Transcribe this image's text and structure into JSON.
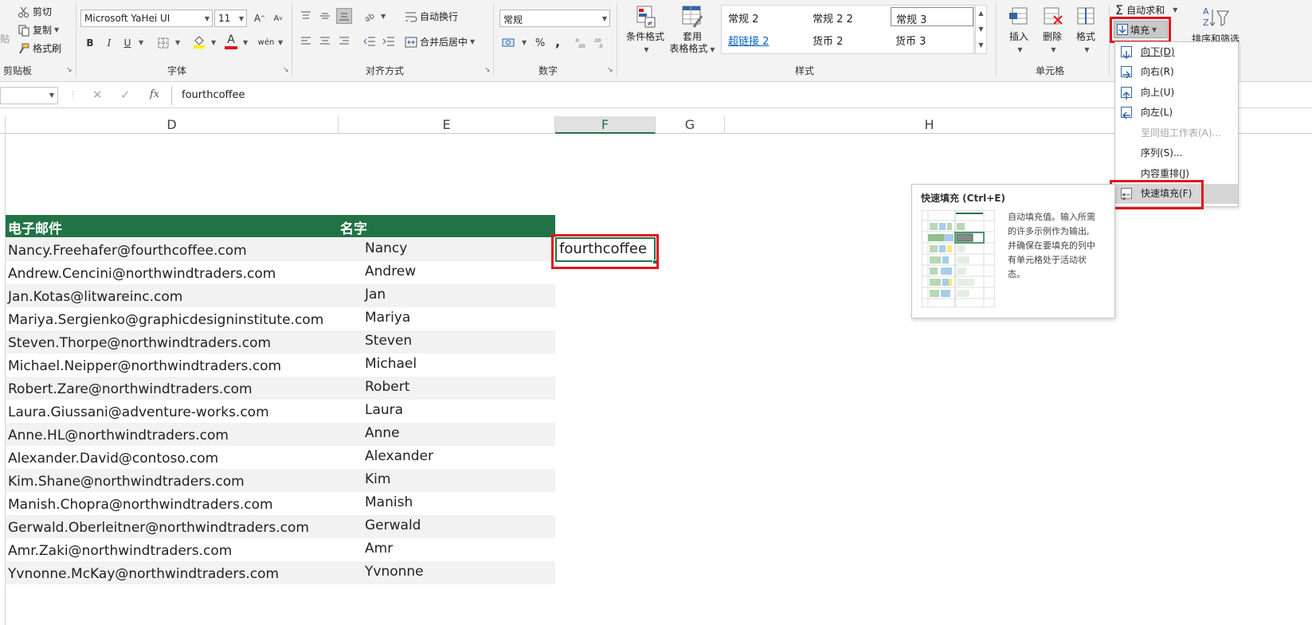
{
  "ribbon": {
    "clipboard": {
      "cut": "剪切",
      "copy": "复制",
      "format_painter": "格式刷",
      "label": "剪贴板",
      "paste_partial": "贴"
    },
    "font": {
      "name": "Microsoft YaHei UI",
      "size": "11",
      "label": "字体",
      "bold": "B",
      "italic": "I",
      "underline": "U",
      "font_color_glyph": "A",
      "phonetic_glyph": "wén"
    },
    "alignment": {
      "wrap_text": "自动换行",
      "merge_center": "合并后居中",
      "label": "对齐方式"
    },
    "number": {
      "format": "常规",
      "percent": "%",
      "comma": ",",
      "label": "数字"
    },
    "styles": {
      "conditional_format": "条件格式",
      "table_format_1": "套用",
      "table_format_2": "表格格式",
      "cells": [
        {
          "text": "常规 2",
          "link": false
        },
        {
          "text": "常规 2 2",
          "link": false
        },
        {
          "text": "常规 3",
          "link": false,
          "selected": true
        },
        {
          "text": "超链接 2",
          "link": true
        },
        {
          "text": "货币 2",
          "link": false
        },
        {
          "text": "货币 3",
          "link": false
        }
      ],
      "label": "样式"
    },
    "cells": {
      "insert": "插入",
      "delete": "删除",
      "format": "格式",
      "label": "单元格"
    },
    "editing": {
      "autosum": "自动求和",
      "fill": "填充",
      "sort_filter": "排序和筛选"
    }
  },
  "formula_bar": {
    "fx": "fx",
    "content": "fourthcoffee"
  },
  "columns": [
    {
      "label": "D"
    },
    {
      "label": "E"
    },
    {
      "label": "F",
      "selected": true
    },
    {
      "label": "G"
    },
    {
      "label": "H"
    }
  ],
  "table": {
    "headers": [
      "电子邮件",
      "名字"
    ],
    "rows": [
      {
        "email": "Nancy.Freehafer@fourthcoffee.com",
        "name": "Nancy"
      },
      {
        "email": "Andrew.Cencini@northwindtraders.com",
        "name": "Andrew"
      },
      {
        "email": "Jan.Kotas@litwareinc.com",
        "name": "Jan"
      },
      {
        "email": "Mariya.Sergienko@graphicdesigninstitute.com",
        "name": "Mariya"
      },
      {
        "email": "Steven.Thorpe@northwindtraders.com",
        "name": "Steven"
      },
      {
        "email": "Michael.Neipper@northwindtraders.com",
        "name": "Michael"
      },
      {
        "email": "Robert.Zare@northwindtraders.com",
        "name": "Robert"
      },
      {
        "email": "Laura.Giussani@adventure-works.com",
        "name": "Laura"
      },
      {
        "email": "Anne.HL@northwindtraders.com",
        "name": "Anne"
      },
      {
        "email": "Alexander.David@contoso.com",
        "name": "Alexander"
      },
      {
        "email": "Kim.Shane@northwindtraders.com",
        "name": "Kim"
      },
      {
        "email": "Manish.Chopra@northwindtraders.com",
        "name": "Manish"
      },
      {
        "email": "Gerwald.Oberleitner@northwindtraders.com",
        "name": "Gerwald"
      },
      {
        "email": "Amr.Zaki@northwindtraders.com",
        "name": "Amr"
      },
      {
        "email": "Yvnonne.McKay@northwindtraders.com",
        "name": "Yvnonne"
      }
    ],
    "active_cell_value": "fourthcoffee"
  },
  "fill_menu": {
    "items": [
      {
        "label": "向下(D)",
        "icon": "arrow-down-icon"
      },
      {
        "label": "向右(R)",
        "icon": "arrow-right-icon"
      },
      {
        "label": "向上(U)",
        "icon": "arrow-up-icon"
      },
      {
        "label": "向左(L)",
        "icon": "arrow-left-icon"
      },
      {
        "label": "至同组工作表(A)...",
        "disabled": true
      },
      {
        "label": "序列(S)..."
      },
      {
        "label": "内容重排(J)"
      },
      {
        "label": "快速填充(F)",
        "icon": "flash-fill-icon",
        "highlighted": true
      }
    ]
  },
  "tooltip": {
    "title": "快速填充 (Ctrl+E)",
    "lines": [
      "自动填充值。输入所需",
      "的许多示例作为输出,",
      "并确保在要填充的列中",
      "有单元格处于活动状",
      "态。"
    ]
  },
  "colors": {
    "table_header": "#217346",
    "highlight_red": "#e3141b",
    "hyperlink": "#0563c1"
  }
}
